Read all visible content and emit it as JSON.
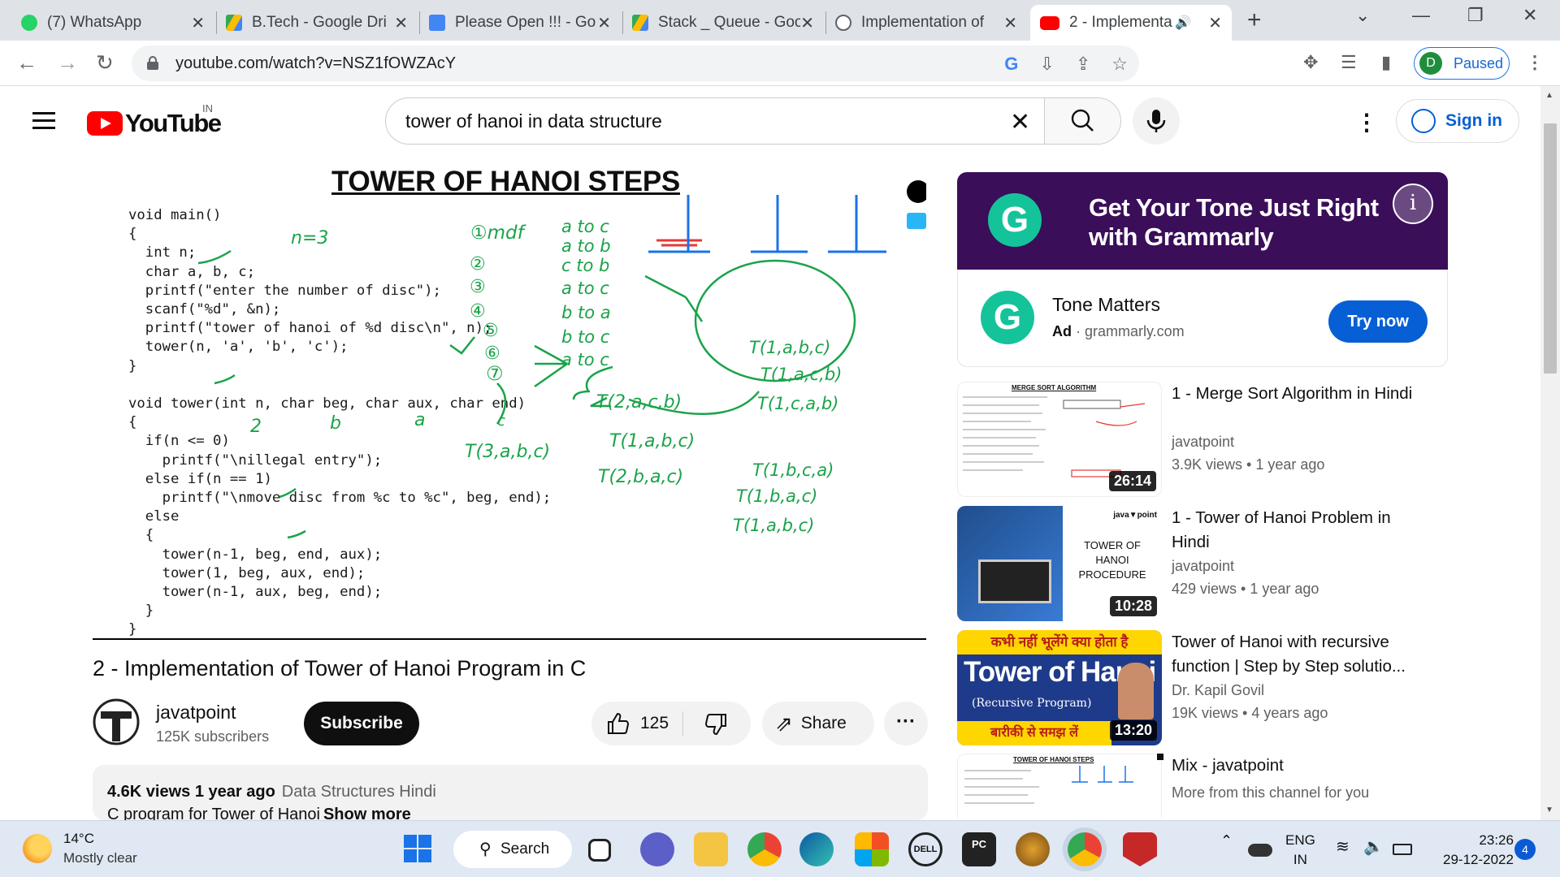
{
  "browser": {
    "tabs": [
      {
        "title": "(7) WhatsApp",
        "icon": "whatsapp-icon",
        "color": "#25d366"
      },
      {
        "title": "B.Tech - Google Dri",
        "icon": "google-drive-icon",
        "color": "#fbbc04"
      },
      {
        "title": "Please Open !!! - Go",
        "icon": "google-docs-icon",
        "color": "#4285f4"
      },
      {
        "title": "Stack _ Queue - Goo",
        "icon": "google-drive-icon",
        "color": "#34a853"
      },
      {
        "title": "Implementation of",
        "icon": "globe-icon",
        "color": "#5f6368"
      },
      {
        "title": "2 - Implementa",
        "icon": "youtube-icon",
        "color": "#ff0000"
      }
    ],
    "url": "youtube.com/watch?v=NSZ1fOWZAcY",
    "profile_initial": "D",
    "profile_status": "Paused"
  },
  "youtube": {
    "logo_text": "YouTube",
    "country": "IN",
    "search_query": "tower of hanoi in data structure",
    "sign_in": "Sign in"
  },
  "slide": {
    "title": "TOWER OF HANOI STEPS",
    "code": "void main()\n{\n  int n;\n  char a, b, c;\n  printf(\"enter the number of disc\");\n  scanf(\"%d\", &n);\n  printf(\"tower of hanoi of %d disc\\n\", n);\n  tower(n, 'a', 'b', 'c');\n}\n\nvoid tower(int n, char beg, char aux, char end)\n{\n  if(n <= 0)\n    printf(\"\\nillegal entry\");\n  else if(n == 1)\n    printf(\"\\nmove disc from %c to %c\", beg, end);\n  else\n  {\n    tower(n-1, beg, end, aux);\n    tower(1, beg, aux, end);\n    tower(n-1, aux, beg, end);\n  }\n}",
    "ink": {
      "n3": "n=3",
      "omdf": "①mdf",
      "moves": [
        "a to c",
        "a to b",
        "c to b",
        "a to c",
        "b to a",
        "b to c",
        "a to c"
      ],
      "steps": [
        "②",
        "③",
        "④",
        "⑤",
        "⑥",
        "⑦"
      ],
      "t3": "T(3,a,b,c)",
      "t2a": "T(2,a,c,b)",
      "t1a": "T(1,a,b,c)",
      "t2b": "T(2,b,a,c)",
      "t1b1": "T(1,a,b,c)",
      "t1b2": "T(1,a,c,b)",
      "t1b3": "T(1,c,a,b)",
      "t1c1": "T(1,b,c,a)",
      "t1c2": "T(1,b,a,c)",
      "t1c3": "T(1,a,b,c)",
      "lbl2": "2",
      "lblb": "b",
      "lbla": "a",
      "lblc": "c"
    }
  },
  "video": {
    "title": "2 - Implementation of Tower of Hanoi Program in C",
    "channel": "javatpoint",
    "subscribers": "125K subscribers",
    "subscribe": "Subscribe",
    "likes": "125",
    "share": "Share",
    "views_date": "4.6K views  1 year ago",
    "tag": "Data Structures Hindi",
    "desc_snippet": "C program for Tower of Hanoi",
    "show_more": "Show more"
  },
  "ad": {
    "headline": "Get Your Tone Just Right with Grammarly",
    "title": "Tone Matters",
    "ad_label": "Ad",
    "domain": "grammarly.com",
    "cta": "Try now"
  },
  "recommendations": [
    {
      "title": "1 - Merge Sort Algorithm in Hindi",
      "channel": "javatpoint",
      "views": "3.9K views",
      "age": "1 year ago",
      "duration": "26:14",
      "thumb": "MERGE SORT ALGORITHM"
    },
    {
      "title": "1 - Tower of Hanoi Problem in Hindi",
      "channel": "javatpoint",
      "views": "429 views",
      "age": "1 year ago",
      "duration": "10:28",
      "thumb": "TOWER OF HANOI PROCEDURE"
    },
    {
      "title": "Tower of Hanoi with recursive function | Step by Step solutio...",
      "channel": "Dr. Kapil Govil",
      "views": "19K views",
      "age": "4 years ago",
      "duration": "13:20",
      "thumb": "Tower of Hanoi"
    },
    {
      "title": "Mix - javatpoint",
      "channel": "More from this channel for you",
      "views": "",
      "age": "",
      "duration": "",
      "thumb": "TOWER OF HANOI STEPS"
    }
  ],
  "thumb3": {
    "top": "कभी नहीं भूलेंगे क्या होता है",
    "mid": "(Recursive  Program)",
    "bottom": "बारीकी से समझ लें"
  },
  "taskbar": {
    "temp": "14°C",
    "weather": "Mostly clear",
    "search": "Search",
    "lang1": "ENG",
    "lang2": "IN",
    "time": "23:26",
    "date": "29-12-2022",
    "notifications": "4"
  }
}
